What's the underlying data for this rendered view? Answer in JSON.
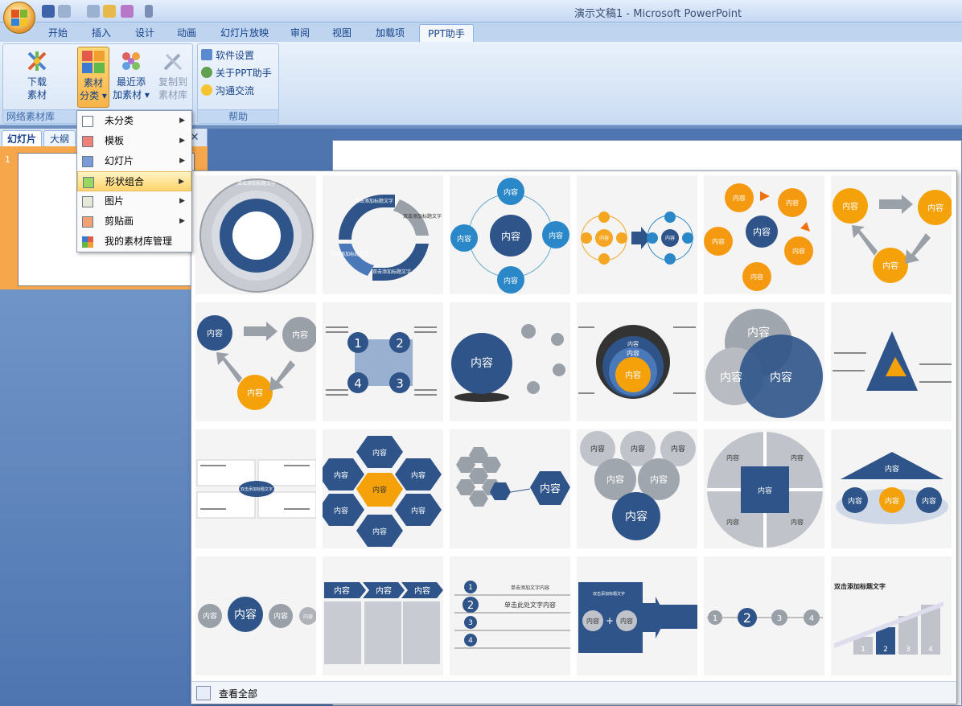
{
  "window": {
    "title": "演示文稿1 - Microsoft PowerPoint"
  },
  "tabs": [
    {
      "label": "开始"
    },
    {
      "label": "插入"
    },
    {
      "label": "设计"
    },
    {
      "label": "动画"
    },
    {
      "label": "幻灯片放映"
    },
    {
      "label": "审阅"
    },
    {
      "label": "视图"
    },
    {
      "label": "加载项"
    },
    {
      "label": "PPT助手"
    }
  ],
  "active_tab": "PPT助手",
  "ribbon": {
    "group_network": {
      "label": "网络素材库",
      "download": {
        "line1": "下载",
        "line2": "素材"
      },
      "category": {
        "line1": "素材",
        "line2": "分类"
      },
      "recent": {
        "line1": "最近添",
        "line2": "加素材"
      },
      "copy": {
        "line1": "复制到",
        "line2": "素材库"
      }
    },
    "group_help": {
      "label": "帮助",
      "settings": "软件设置",
      "about": "关于PPT助手",
      "contact": "沟通交流"
    }
  },
  "panes": {
    "slides_tab": "幻灯片",
    "outline_tab": "大纲",
    "slide_number": "1"
  },
  "menu": {
    "items": [
      {
        "label": "未分类",
        "color": "#ffffff",
        "submenu": true
      },
      {
        "label": "模板",
        "color": "#f08078",
        "submenu": true
      },
      {
        "label": "幻灯片",
        "color": "#7b9bd8",
        "submenu": true
      },
      {
        "label": "形状组合",
        "color": "#98d860",
        "submenu": true,
        "highlighted": true
      },
      {
        "label": "图片",
        "color": "#e8e8d8",
        "submenu": true
      },
      {
        "label": "剪贴画",
        "color": "#f4a070",
        "submenu": true
      },
      {
        "label": "我的素材库管理",
        "color": "multi",
        "submenu": false
      }
    ]
  },
  "gallery": {
    "labels": {
      "content": "内容",
      "title_placeholder": "双击添加标题文字",
      "click_add_text": "单击此处添加文字内容",
      "click_add_text2": "单击添加文字内容",
      "click_text": "单击此处文字内容",
      "n1": "1",
      "n2": "2",
      "n3": "3",
      "n4": "4"
    },
    "footer": "查看全部"
  }
}
